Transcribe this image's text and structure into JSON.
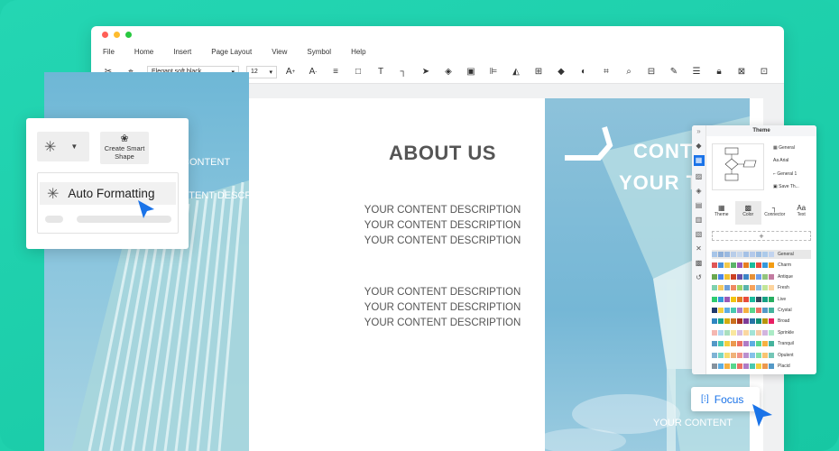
{
  "menu": [
    "File",
    "Home",
    "Insert",
    "Page Layout",
    "View",
    "Symbol",
    "Help"
  ],
  "toolbar": {
    "font_name": "Elegant soft black",
    "font_size": "12"
  },
  "brochure": {
    "left_heading": "CONTENT",
    "left_desc": "YOUR CONTENT DESCRIPTION",
    "about_title": "ABOUT US",
    "desc_block_1": [
      "YOUR CONTENT DESCRIPTION",
      "YOUR CONTENT DESCRIPTION",
      "YOUR CONTENT DESCRIPTION"
    ],
    "desc_block_2": [
      "YOUR CONTENT DESCRIPTION",
      "YOUR CONTENT DESCRIPTION",
      "YOUR CONTENT DESCRIPTION"
    ],
    "right_title_1": "CONT",
    "right_title_2": "YOUR T",
    "right_footer": "YOUR CONTENT"
  },
  "popup": {
    "smart_shape_label": "Create Smart Shape",
    "auto_formatting_label": "Auto Formatting"
  },
  "theme_panel": {
    "title": "Theme",
    "preview_items": [
      "General",
      "Arial",
      "General 1",
      "Save Th..."
    ],
    "tabs": [
      "Theme",
      "Color",
      "Connector",
      "Text"
    ],
    "add_label": "+",
    "schemes": [
      {
        "name": "General",
        "colors": [
          "#a7c5e8",
          "#8fb0d9",
          "#9ab9e0",
          "#b8cde9",
          "#c7d7ec",
          "#a4c1e6",
          "#b3c9ea",
          "#9cbde2",
          "#accaea",
          "#c1d3ef"
        ]
      },
      {
        "name": "Charm",
        "colors": [
          "#e05757",
          "#4a90d9",
          "#f2c94c",
          "#5bb36a",
          "#9b59b6",
          "#e67e22",
          "#1abc9c",
          "#e74c3c",
          "#3498db",
          "#f39c12"
        ]
      },
      {
        "name": "Antique",
        "colors": [
          "#6aa84f",
          "#4a86e8",
          "#f1c232",
          "#cc4125",
          "#674ea7",
          "#3d85c6",
          "#e69138",
          "#6d9eeb",
          "#93c47d",
          "#c27ba0"
        ]
      },
      {
        "name": "Fresh",
        "colors": [
          "#7fd1ae",
          "#f6c85f",
          "#6f9fd8",
          "#ef8a62",
          "#9ed36a",
          "#5ab4ac",
          "#f7a35c",
          "#8dbbe0",
          "#c2e699",
          "#fdd49e"
        ]
      },
      {
        "name": "Live",
        "colors": [
          "#2ecc71",
          "#3498db",
          "#9b59b6",
          "#f1c40f",
          "#e67e22",
          "#e74c3c",
          "#1abc9c",
          "#34495e",
          "#16a085",
          "#27ae60"
        ]
      },
      {
        "name": "Crystal",
        "colors": [
          "#1f3a6d",
          "#f4d03f",
          "#5dade2",
          "#48c9b0",
          "#af7ac5",
          "#f5b041",
          "#58d68d",
          "#ec7063",
          "#5499c7",
          "#45b39d"
        ]
      },
      {
        "name": "Broad",
        "colors": [
          "#2e86c1",
          "#17a589",
          "#d4ac0d",
          "#ca6f1e",
          "#a93226",
          "#7d3c98",
          "#2874a6",
          "#138d75",
          "#b7950b",
          "#e91e63"
        ]
      },
      {
        "name": "Sprinkle",
        "colors": [
          "#f5b7b1",
          "#aed6f1",
          "#a9dfbf",
          "#f9e79f",
          "#d7bde2",
          "#fad7a0",
          "#a3e4d7",
          "#f5cba7",
          "#d2b4de",
          "#abebc6"
        ]
      },
      {
        "name": "Tranquil",
        "colors": [
          "#5499c7",
          "#48c9b0",
          "#f4d03f",
          "#eb984e",
          "#ec7063",
          "#af7ac5",
          "#5dade2",
          "#58d68d",
          "#f5b041",
          "#45b39d"
        ]
      },
      {
        "name": "Opulent",
        "colors": [
          "#7fb3d5",
          "#76d7c4",
          "#f7dc6f",
          "#f0b27a",
          "#f1948a",
          "#bb8fce",
          "#85c1e9",
          "#82e0aa",
          "#f8c471",
          "#73c6b6"
        ]
      },
      {
        "name": "Placid",
        "colors": [
          "#85929e",
          "#5dade2",
          "#f5b041",
          "#58d68d",
          "#ec7063",
          "#af7ac5",
          "#48c9b0",
          "#f4d03f",
          "#eb984e",
          "#5499c7"
        ]
      }
    ]
  },
  "focus_label": "Focus",
  "colors": {
    "background": "#1fd1ad",
    "accent_blue": "#1a73e8",
    "text_gray": "#555555"
  }
}
